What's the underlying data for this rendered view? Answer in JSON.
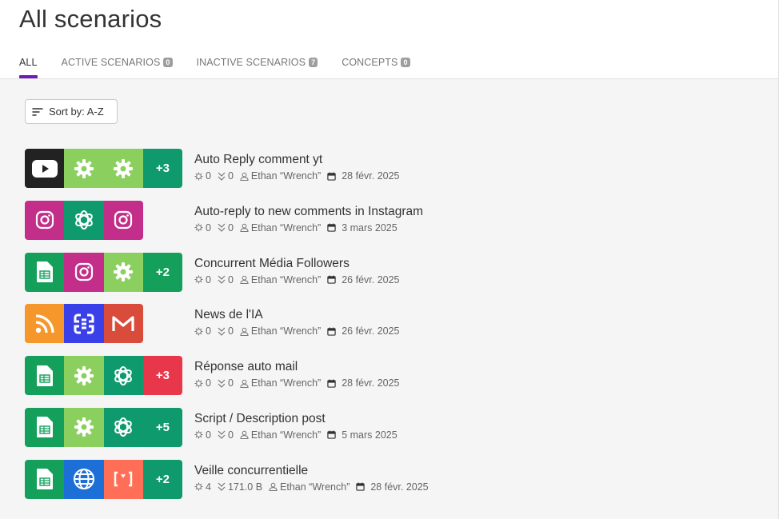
{
  "page": {
    "title": "All scenarios"
  },
  "tabs": [
    {
      "label": "ALL",
      "badge": null,
      "active": true
    },
    {
      "label": "ACTIVE SCENARIOS",
      "badge": "0",
      "active": false
    },
    {
      "label": "INACTIVE SCENARIOS",
      "badge": "7",
      "active": false
    },
    {
      "label": "CONCEPTS",
      "badge": "0",
      "active": false
    }
  ],
  "sort": {
    "label": "Sort by: A-Z"
  },
  "colors": {
    "accent": "#6f1ab8",
    "sheets": "#14a05a",
    "instagram": "#c22e89",
    "gear": "#8bd05e",
    "teal": "#10a37f",
    "youtube": "#222222",
    "rss": "#f5972a",
    "blue": "#3a40e8",
    "gmail": "#d94b3b",
    "red": "#e8364a",
    "globe": "#1c6fd6",
    "orange": "#ff6f57"
  },
  "scenarios": [
    {
      "name": "Auto Reply comment yt",
      "ops": "0",
      "transfer": "0",
      "author": "Ethan “Wrench”",
      "date": "28 févr. 2025",
      "apps": [
        {
          "icon": "youtube-icon",
          "color": "#222222"
        },
        {
          "icon": "gear-icon",
          "color": "#8bd05e"
        },
        {
          "icon": "gear-icon",
          "color": "#8bd05e"
        }
      ],
      "more": "+3",
      "more_color": "#0f9a6e"
    },
    {
      "name": "Auto-reply to new comments in Instagram",
      "ops": "0",
      "transfer": "0",
      "author": "Ethan “Wrench”",
      "date": "3 mars 2025",
      "apps": [
        {
          "icon": "instagram-icon",
          "color": "#c22e89"
        },
        {
          "icon": "openai-icon",
          "color": "#0f9a6e"
        },
        {
          "icon": "instagram-icon",
          "color": "#c22e89"
        }
      ],
      "more": "",
      "more_color": ""
    },
    {
      "name": "Concurrent Média Followers",
      "ops": "0",
      "transfer": "0",
      "author": "Ethan “Wrench”",
      "date": "26 févr. 2025",
      "apps": [
        {
          "icon": "sheets-icon",
          "color": "#14a05a"
        },
        {
          "icon": "instagram-icon",
          "color": "#c22e89"
        },
        {
          "icon": "gear-icon",
          "color": "#8bd05e"
        }
      ],
      "more": "+2",
      "more_color": "#14a05a"
    },
    {
      "name": "News de l'IA",
      "ops": "0",
      "transfer": "0",
      "author": "Ethan “Wrench”",
      "date": "26 févr. 2025",
      "apps": [
        {
          "icon": "rss-icon",
          "color": "#f5972a"
        },
        {
          "icon": "iterator-icon",
          "color": "#3a40e8"
        },
        {
          "icon": "gmail-icon",
          "color": "#d94b3b"
        }
      ],
      "more": "",
      "more_color": ""
    },
    {
      "name": "Réponse auto mail",
      "ops": "0",
      "transfer": "0",
      "author": "Ethan “Wrench”",
      "date": "28 févr. 2025",
      "apps": [
        {
          "icon": "sheets-icon",
          "color": "#14a05a"
        },
        {
          "icon": "gear-icon",
          "color": "#8bd05e"
        },
        {
          "icon": "openai-icon",
          "color": "#0f9a6e"
        }
      ],
      "more": "+3",
      "more_color": "#e8364a"
    },
    {
      "name": "Script / Description post",
      "ops": "0",
      "transfer": "0",
      "author": "Ethan “Wrench”",
      "date": "5 mars 2025",
      "apps": [
        {
          "icon": "sheets-icon",
          "color": "#14a05a"
        },
        {
          "icon": "gear-icon",
          "color": "#8bd05e"
        },
        {
          "icon": "openai-icon",
          "color": "#0f9a6e"
        }
      ],
      "more": "+5",
      "more_color": "#0f9a6e"
    },
    {
      "name": "Veille concurrentielle",
      "ops": "4",
      "transfer": "171.0 B",
      "author": "Ethan “Wrench”",
      "date": "28 févr. 2025",
      "apps": [
        {
          "icon": "sheets-icon",
          "color": "#14a05a"
        },
        {
          "icon": "globe-icon",
          "color": "#1c6fd6"
        },
        {
          "icon": "json-icon",
          "color": "#ff6f57"
        }
      ],
      "more": "+2",
      "more_color": "#0f9a6e"
    }
  ]
}
